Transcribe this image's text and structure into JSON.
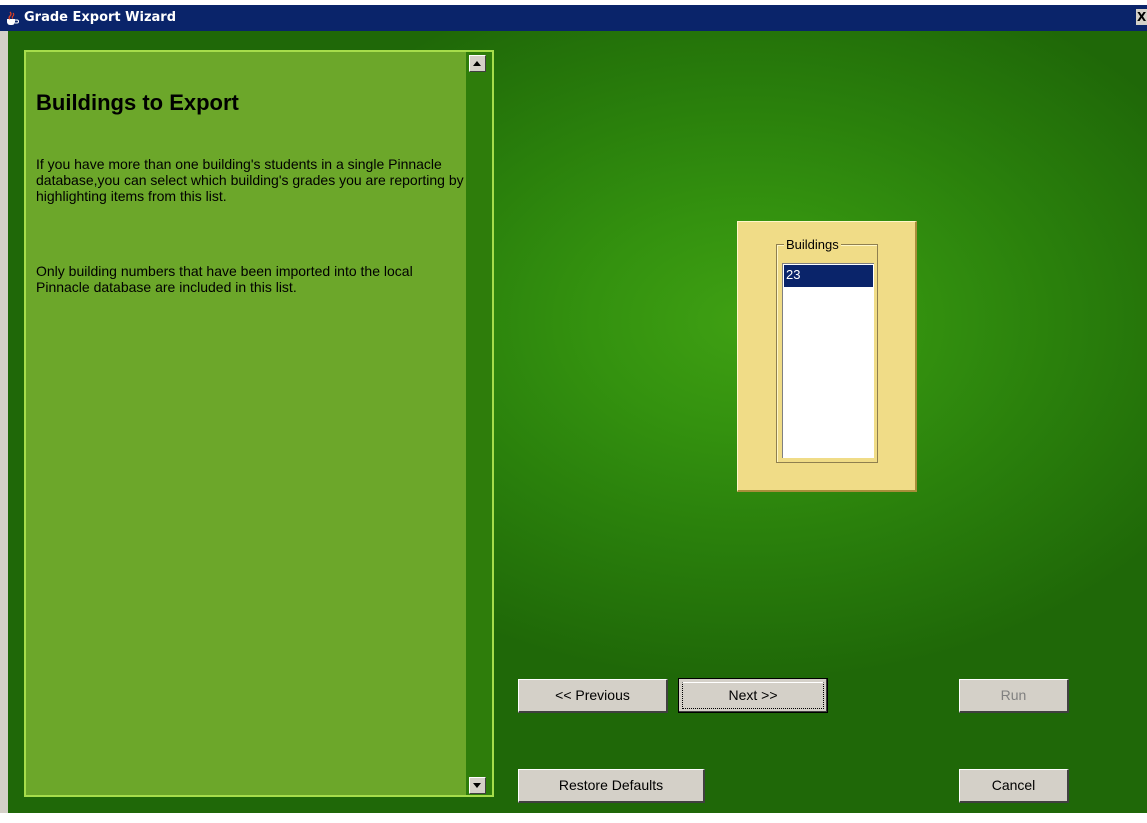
{
  "window": {
    "title": "Grade Export Wizard",
    "icon": "java-cup-icon",
    "close_label": "X"
  },
  "help": {
    "title": "Buildings to Export",
    "paragraphs": [
      "If you have more than one building's students in a single Pinnacle database,you can select which building's grades you are reporting by highlighting items from this list.",
      "Only building numbers that have been imported into the local Pinnacle database are included in this list."
    ]
  },
  "buildings": {
    "label": "Buildings",
    "items": [
      "23"
    ],
    "selected": "23"
  },
  "buttons": {
    "previous": "<< Previous",
    "next": "Next >>",
    "run": "Run",
    "restore_defaults": "Restore Defaults",
    "cancel": "Cancel"
  },
  "colors": {
    "title_bar": "#0a246a",
    "background_green": "#2a800c",
    "help_panel": "#6ca72a",
    "buildings_box": "#f0dc87",
    "selection": "#0a246a"
  }
}
